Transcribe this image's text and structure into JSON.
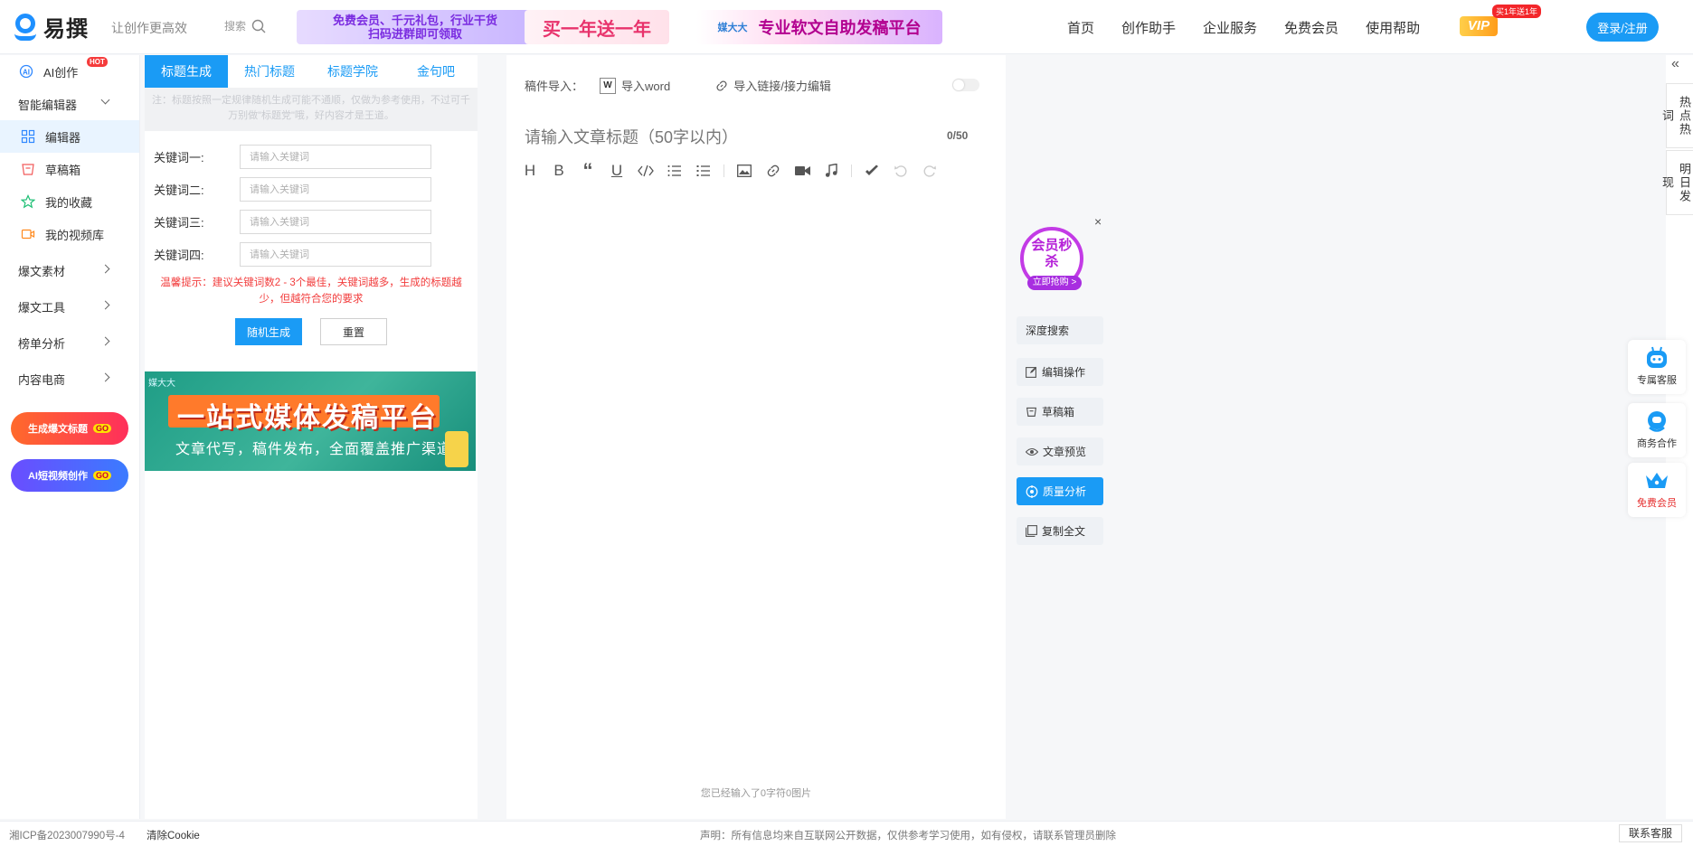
{
  "brand": {
    "name": "易撰",
    "slogan": "让创作更高效",
    "search_label": "搜索"
  },
  "banners": {
    "promo1": {
      "line1": "免费会员、千元礼包，行业干货",
      "line2": "扫码进群即可领取"
    },
    "promo2": "买一年送一年",
    "promo3": {
      "mini": "媒大大",
      "text": "专业软文自助发稿平台"
    }
  },
  "topnav": [
    "首页",
    "创作助手",
    "企业服务",
    "免费会员",
    "使用帮助"
  ],
  "vip": {
    "label": "VIP",
    "badge": "买1年送1年"
  },
  "login_label": "登录/注册",
  "sidebar": {
    "items": [
      {
        "label": "AI创作",
        "badge": "HOT"
      },
      {
        "label": "智能编辑器"
      },
      {
        "label": "编辑器"
      },
      {
        "label": "草稿箱"
      },
      {
        "label": "我的收藏"
      },
      {
        "label": "我的视频库"
      },
      {
        "label": "爆文素材"
      },
      {
        "label": "爆文工具"
      },
      {
        "label": "榜单分析"
      },
      {
        "label": "内容电商"
      }
    ],
    "promos": [
      {
        "label": "生成爆文标题",
        "go": "GO"
      },
      {
        "label": "AI短视频创作",
        "go": "GO"
      }
    ]
  },
  "panel": {
    "tabs": [
      "标题生成",
      "热门标题",
      "标题学院",
      "金句吧"
    ],
    "notice": "注：标题按照一定规律随机生成可能不通顺，仅做为参考使用，不过可千万别做\"标题党\"哦，好内容才是王道。",
    "keywords": [
      {
        "label": "关键词一:",
        "placeholder": "请输入关键词"
      },
      {
        "label": "关键词二:",
        "placeholder": "请输入关键词"
      },
      {
        "label": "关键词三:",
        "placeholder": "请输入关键词"
      },
      {
        "label": "关键词四:",
        "placeholder": "请输入关键词"
      }
    ],
    "tip": "温馨提示：建议关键词数2 - 3个最佳，关键词越多，生成的标题越少，但越符合您的要求",
    "generate_label": "随机生成",
    "reset_label": "重置",
    "ad": {
      "logo": "媒大大",
      "title": "一站式媒体发稿平台",
      "subtitle": "文章代写，稿件发布，全面覆盖推广渠道"
    }
  },
  "editor": {
    "import_label": "稿件导入：",
    "import_word": "导入word",
    "import_word_icon": "W",
    "import_link": "导入链接/接力编辑",
    "title_placeholder": "请输入文章标题（50字以内）",
    "char_count": "0/50",
    "status": "您已经输入了0字符0图片",
    "toolbar": [
      "H",
      "B",
      "“",
      "U"
    ]
  },
  "side_tools": {
    "flash": {
      "text": "会员秒杀",
      "cta": "立即抢购 >"
    },
    "close": "×",
    "buttons": [
      {
        "label": "深度搜索",
        "active": false
      },
      {
        "label": "编辑操作",
        "active": false
      },
      {
        "label": "草稿箱",
        "active": false
      },
      {
        "label": "文章预览",
        "active": false
      },
      {
        "label": "质量分析",
        "active": true
      },
      {
        "label": "复制全文",
        "active": false
      }
    ]
  },
  "right_edge": {
    "collapse": "«",
    "tabs": [
      "热点热词",
      "明日发现"
    ],
    "cards": [
      {
        "label": "专属客服"
      },
      {
        "label": "商务合作"
      },
      {
        "label": "免费会员"
      }
    ]
  },
  "footer": {
    "icp": "湘ICP备2023007990号-4",
    "cookie": "清除Cookie",
    "declare": "声明：所有信息均来自互联网公开数据，仅供参考学习使用，如有侵权，请联系管理员删除",
    "contact": "联系客服"
  },
  "colors": {
    "accent": "#1a9bf5",
    "warning": "#f23c3c",
    "vip": "#e52c2c"
  }
}
